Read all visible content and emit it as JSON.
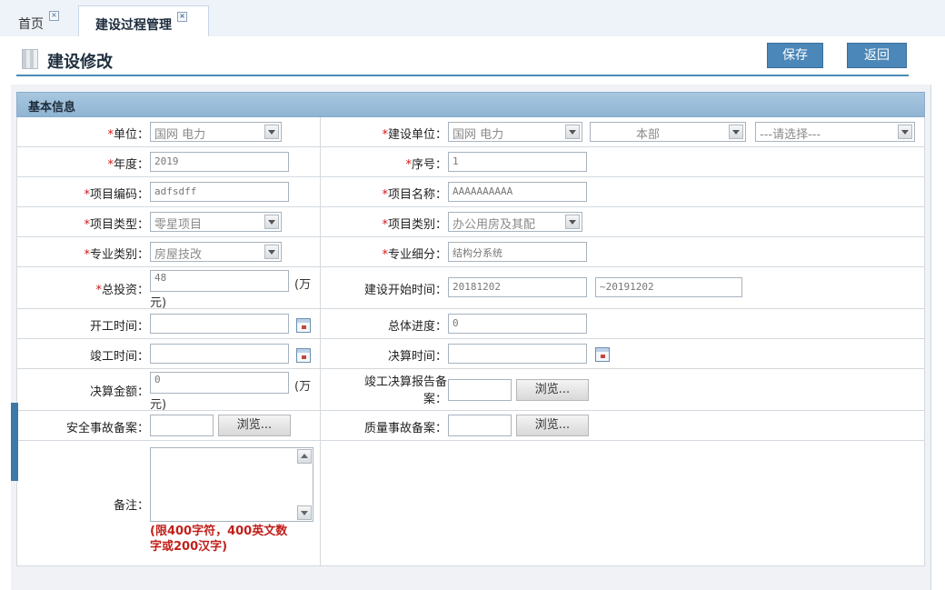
{
  "tabs": [
    {
      "label": "首页"
    },
    {
      "label": "建设过程管理"
    }
  ],
  "header": {
    "title": "建设修改",
    "save_label": "保存",
    "back_label": "返回"
  },
  "section": {
    "title": "基本信息"
  },
  "form": {
    "unit": {
      "label": "单位：",
      "value": "国网      电力"
    },
    "build_unit": {
      "label": "建设单位：",
      "value1": "国网      电力",
      "value2": "本部",
      "value3": "---请选择---"
    },
    "year": {
      "label": "年度：",
      "value": "2019"
    },
    "seq": {
      "label": "序号：",
      "value": "1"
    },
    "project_code": {
      "label": "项目编码：",
      "value": "adfsdff"
    },
    "project_name": {
      "label": "项目名称：",
      "value": "AAAAAAAAAA"
    },
    "project_type": {
      "label": "项目类型：",
      "value": "零星项目"
    },
    "project_category": {
      "label": "项目类别：",
      "value": "办公用房及其配"
    },
    "major_category": {
      "label": "专业类别：",
      "value": "房屋技改"
    },
    "major_detail": {
      "label": "专业细分：",
      "value": "结构分系统"
    },
    "total_invest": {
      "label": "总投资：",
      "value": "48",
      "unit_a": "(万",
      "unit_b": "元)"
    },
    "build_start": {
      "label": "建设开始时间：",
      "from": "20181202",
      "to": "~20191202"
    },
    "start_time": {
      "label": "开工时间：",
      "value": ""
    },
    "overall_progress": {
      "label": "总体进度：",
      "value": "0"
    },
    "complete_time": {
      "label": "竣工时间：",
      "value": ""
    },
    "settle_time": {
      "label": "决算时间：",
      "value": ""
    },
    "settle_amount": {
      "label": "决算金额：",
      "value": "0",
      "unit_a": "(万",
      "unit_b": "元)"
    },
    "complete_report": {
      "label_a": "竣工决算报告备",
      "label_b": "案：",
      "browse": "浏览..."
    },
    "safety_record": {
      "label": "安全事故备案：",
      "browse": "浏览..."
    },
    "quality_record": {
      "label": "质量事故备案：",
      "browse": "浏览..."
    },
    "remark": {
      "label": "备注：",
      "hint_a": "(限400字符，400英文数",
      "hint_b": "字或200汉字)"
    }
  }
}
